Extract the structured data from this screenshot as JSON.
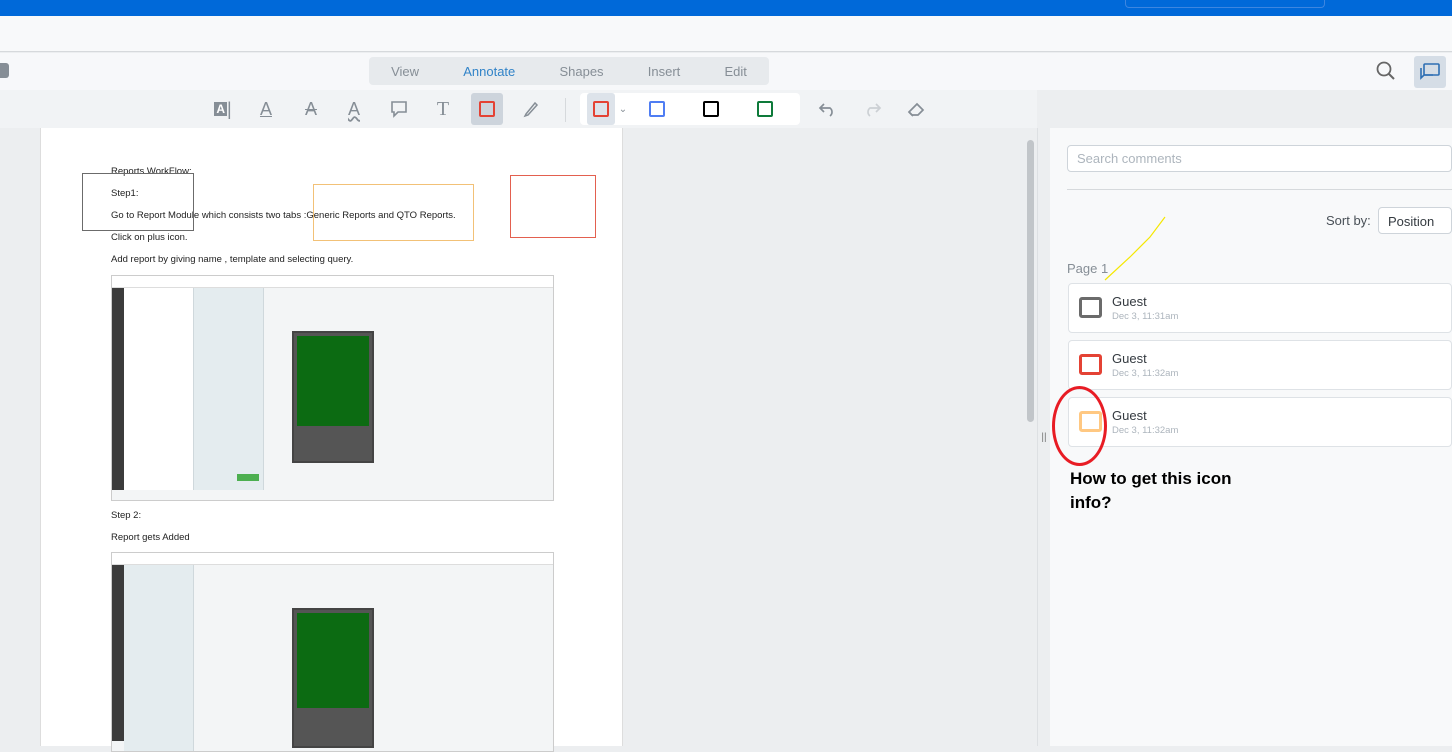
{
  "header": {
    "tabs": [
      {
        "label": "View"
      },
      {
        "label": "Annotate",
        "active": true
      },
      {
        "label": "Shapes"
      },
      {
        "label": "Insert"
      },
      {
        "label": "Edit"
      }
    ]
  },
  "toolbar": {
    "tools": [
      "free-text-icon",
      "underline-icon",
      "strikeout-icon",
      "squiggly-icon",
      "comment-icon",
      "text-icon",
      "rectangle-icon",
      "pen-icon"
    ],
    "selected_tool": "rectangle-icon",
    "colors": [
      "#e44234",
      "#4f7df3",
      "#000000",
      "#0e7a3a"
    ],
    "selected_color": "#e44234"
  },
  "document": {
    "lines": [
      "Reports WorkFlow:",
      "Step1:",
      "Go to Report Module which consists two tabs :Generic Reports and QTO Reports.",
      "Click on plus icon.",
      "Add report by giving name , template and selecting query.",
      "Step 2:",
      "Report gets Added"
    ],
    "annotation_colors": [
      "#6b6b6b",
      "#f2c177",
      "#e3604f"
    ]
  },
  "comments": {
    "search_placeholder": "Search comments",
    "sort_label": "Sort by:",
    "sort_value": "Position",
    "page_label": "Page 1",
    "items": [
      {
        "author": "Guest",
        "time": "Dec 3, 11:31am",
        "color": "#6b6b6b"
      },
      {
        "author": "Guest",
        "time": "Dec 3, 11:32am",
        "color": "#e44234"
      },
      {
        "author": "Guest",
        "time": "Dec 3, 11:32am",
        "color": "#ffc882"
      }
    ]
  },
  "callout": {
    "text_line1": "How to get this icon",
    "text_line2": "info?",
    "circle_color": "#e81c24"
  }
}
